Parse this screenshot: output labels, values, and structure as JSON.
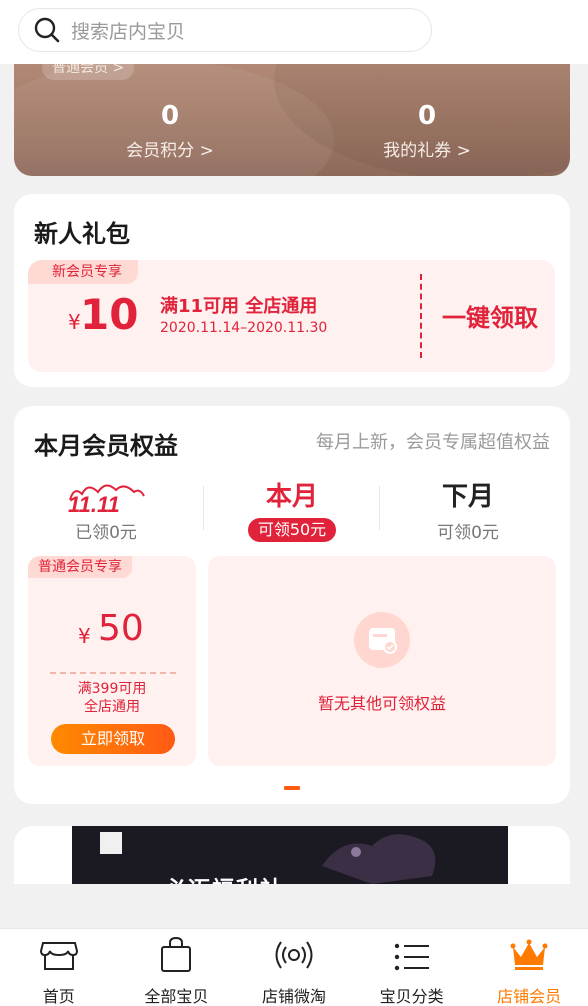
{
  "search": {
    "placeholder": "搜索店内宝贝"
  },
  "member": {
    "level_label": "普通会员 >",
    "points_value": "0",
    "points_label": "会员积分 >",
    "coupons_value": "0",
    "coupons_label": "我的礼券 >"
  },
  "newcomer": {
    "title": "新人礼包",
    "tag": "新会员专享",
    "currency": "¥",
    "amount": "10",
    "condition": "满11可用  全店通用",
    "date_range": "2020.11.14–2020.11.30",
    "claim_label": "一键领取"
  },
  "rights": {
    "title": "本月会员权益",
    "subtitle": "每月上新，会员专属超值权益",
    "tabs": [
      {
        "label": "11.11",
        "sub": "已领0元"
      },
      {
        "label": "本月",
        "sub": "可领50元"
      },
      {
        "label": "下月",
        "sub": "可领0元"
      }
    ],
    "coupon": {
      "tag": "普通会员专享",
      "currency": "¥",
      "amount": "50",
      "condition_line1": "满399可用",
      "condition_line2": "全店通用",
      "button": "立即领取"
    },
    "empty_text": "暂无其他可领权益"
  },
  "banner": {
    "text": "必迈福利社"
  },
  "tabbar": [
    {
      "label": "首页"
    },
    {
      "label": "全部宝贝"
    },
    {
      "label": "店铺微淘"
    },
    {
      "label": "宝贝分类"
    },
    {
      "label": "店铺会员"
    }
  ],
  "colors": {
    "accent_red": "#e0233a",
    "accent_orange": "#ff7a00",
    "member_brown": "#a47c69"
  }
}
